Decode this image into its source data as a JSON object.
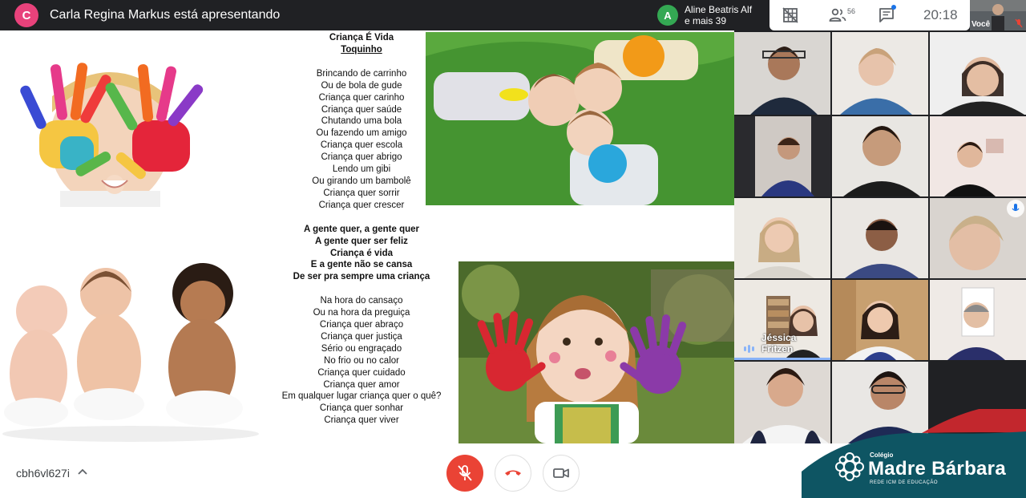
{
  "presenter": {
    "initial": "C",
    "text": "Carla Regina Markus está apresentando"
  },
  "others": {
    "initial": "A",
    "line1": "Aline Beatris Alf",
    "line2": "e mais 39"
  },
  "toolbar": {
    "people_count": "56",
    "clock": "20:18"
  },
  "self_tile": {
    "label": "Você"
  },
  "slide": {
    "poem": {
      "title": "Criança É Vida",
      "author": "Toquinho",
      "stanza1": [
        "Brincando de carrinho",
        "Ou de bola de gude",
        "Criança quer carinho",
        "Criança quer saúde",
        "Chutando uma bola",
        "Ou fazendo um amigo",
        "Criança quer escola",
        "Criança quer abrigo",
        "Lendo um gibi",
        "Ou girando um bambolê",
        "Criança quer sorrir",
        "Criança quer crescer"
      ],
      "chorus": [
        "A gente quer, a gente quer",
        "A gente quer ser feliz",
        "Criança é vida",
        "E a gente não se cansa",
        "De ser pra sempre uma criança"
      ],
      "stanza2": [
        "Na hora do cansaço",
        "Ou na hora da preguiça",
        "Criança quer abraço",
        "Criança quer justiça",
        "Sério ou engraçado",
        "No frio ou no calor",
        "Criança quer cuidado",
        "Criança quer amor",
        "Em qualquer lugar criança quer o quê?",
        "Criança quer sonhar",
        "Criança quer viver"
      ]
    }
  },
  "grid": {
    "speaker_name": "Jéssica Fritzen"
  },
  "bottom": {
    "meeting_code": "cbh6vl627i"
  },
  "logo": {
    "small": "Colégio",
    "name": "Madre Bárbara",
    "sub": "REDE ICM DE EDUCAÇÃO"
  },
  "colors": {
    "mic_off": "#ea4335",
    "hangup": "#ea4335",
    "logo_teal": "#0e5563",
    "logo_red": "#c2272d",
    "presenter": "#e8427b",
    "others": "#34a853"
  }
}
